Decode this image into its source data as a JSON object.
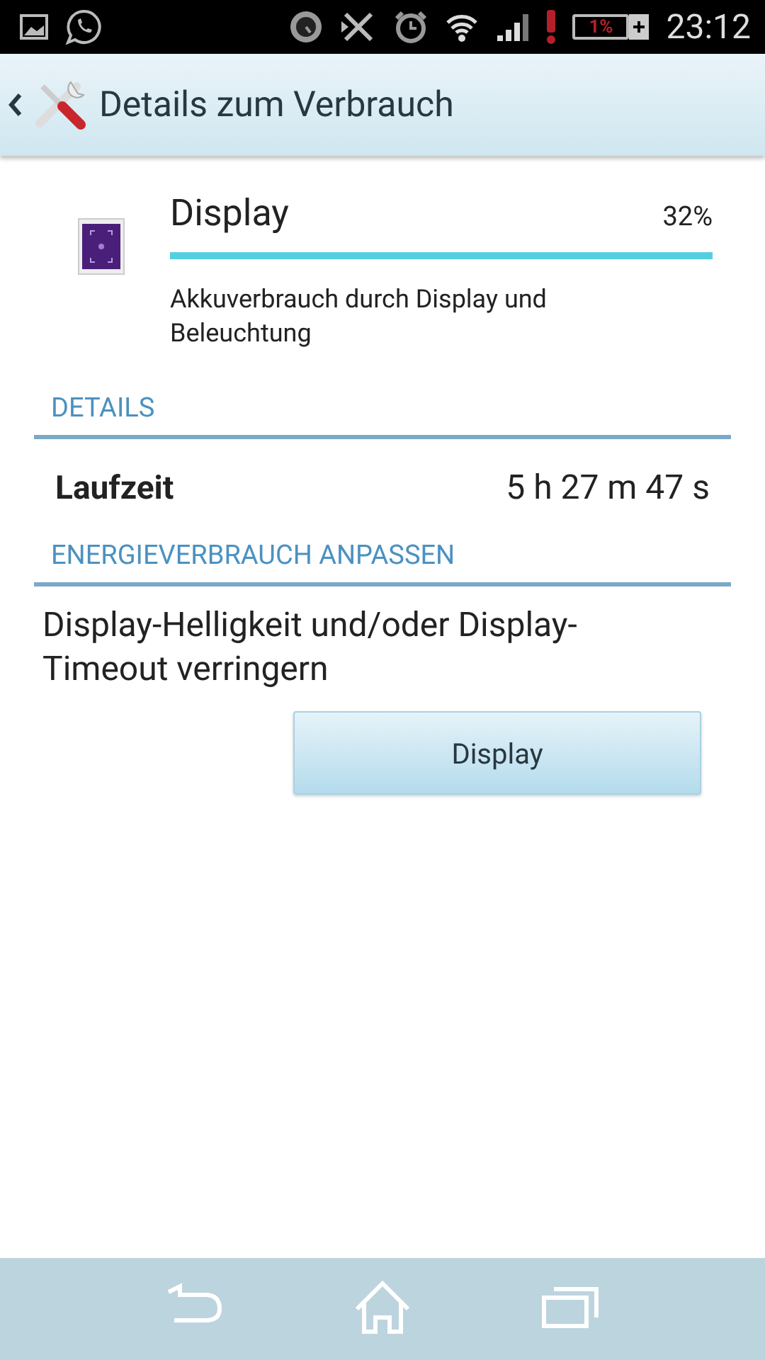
{
  "status_bar": {
    "battery_text": "1%",
    "time": "23:12"
  },
  "action_bar": {
    "title": "Details zum Verbrauch"
  },
  "usage": {
    "name": "Display",
    "percent": "32%",
    "level": 1.0,
    "description": "Akkuverbrauch durch Display und Beleuchtung"
  },
  "sections": [
    {
      "kind": "details",
      "title": "DETAILS",
      "rows": [
        {
          "label": "Laufzeit",
          "value": "5 h 27 m 47 s"
        }
      ]
    },
    {
      "kind": "adjust",
      "title": "ENERGIEVERBRAUCH ANPASSEN",
      "text": "Display-Helligkeit und/oder Display-Timeout verringern",
      "button": "Display"
    }
  ]
}
